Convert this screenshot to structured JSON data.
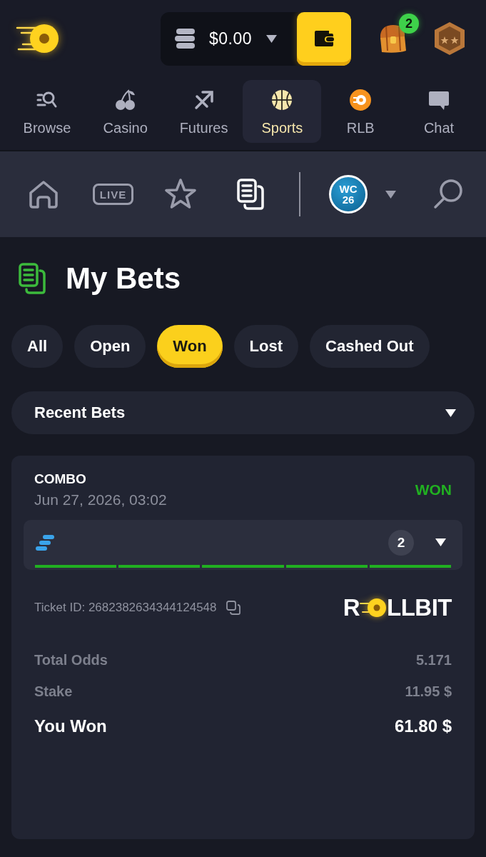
{
  "header": {
    "balance": "$0.00",
    "rewards_count": "2"
  },
  "main_nav": [
    {
      "label": "Browse",
      "kind": "browse",
      "selected": false
    },
    {
      "label": "Casino",
      "kind": "casino",
      "selected": false
    },
    {
      "label": "Futures",
      "kind": "futures",
      "selected": false
    },
    {
      "label": "Sports",
      "kind": "sports",
      "selected": true
    },
    {
      "label": "RLB",
      "kind": "rlb",
      "selected": false
    },
    {
      "label": "Chat",
      "kind": "chat",
      "selected": false
    }
  ],
  "sports_nav": {
    "items": [
      {
        "kind": "home",
        "selected": false
      },
      {
        "kind": "live",
        "label": "LIVE",
        "selected": false
      },
      {
        "kind": "favorites",
        "selected": false
      },
      {
        "kind": "my_bets",
        "selected": true
      }
    ],
    "league_badge": [
      "WC",
      "26"
    ]
  },
  "page_title": "My Bets",
  "filters": [
    {
      "label": "All",
      "selected": false
    },
    {
      "label": "Open",
      "selected": false
    },
    {
      "label": "Won",
      "selected": true
    },
    {
      "label": "Lost",
      "selected": false
    },
    {
      "label": "Cashed Out",
      "selected": false
    }
  ],
  "sort_dropdown": {
    "value": "Recent Bets"
  },
  "bets": [
    {
      "type": "COMBO",
      "date": "Jun 27, 2026, 03:02",
      "status": {
        "label": "WON",
        "kind": "won"
      },
      "legs_count": "2",
      "ticket_id": "Ticket ID: 2682382634344124548",
      "brand": {
        "start": "R",
        "end": "LLBIT"
      },
      "rows": [
        {
          "label": "Total Odds",
          "value": "5.171",
          "kind": "detail"
        },
        {
          "label": "Stake",
          "value": "11.95 $",
          "kind": "detail"
        },
        {
          "label": "You Won",
          "value": "61.80 $",
          "kind": "total"
        }
      ]
    }
  ]
}
